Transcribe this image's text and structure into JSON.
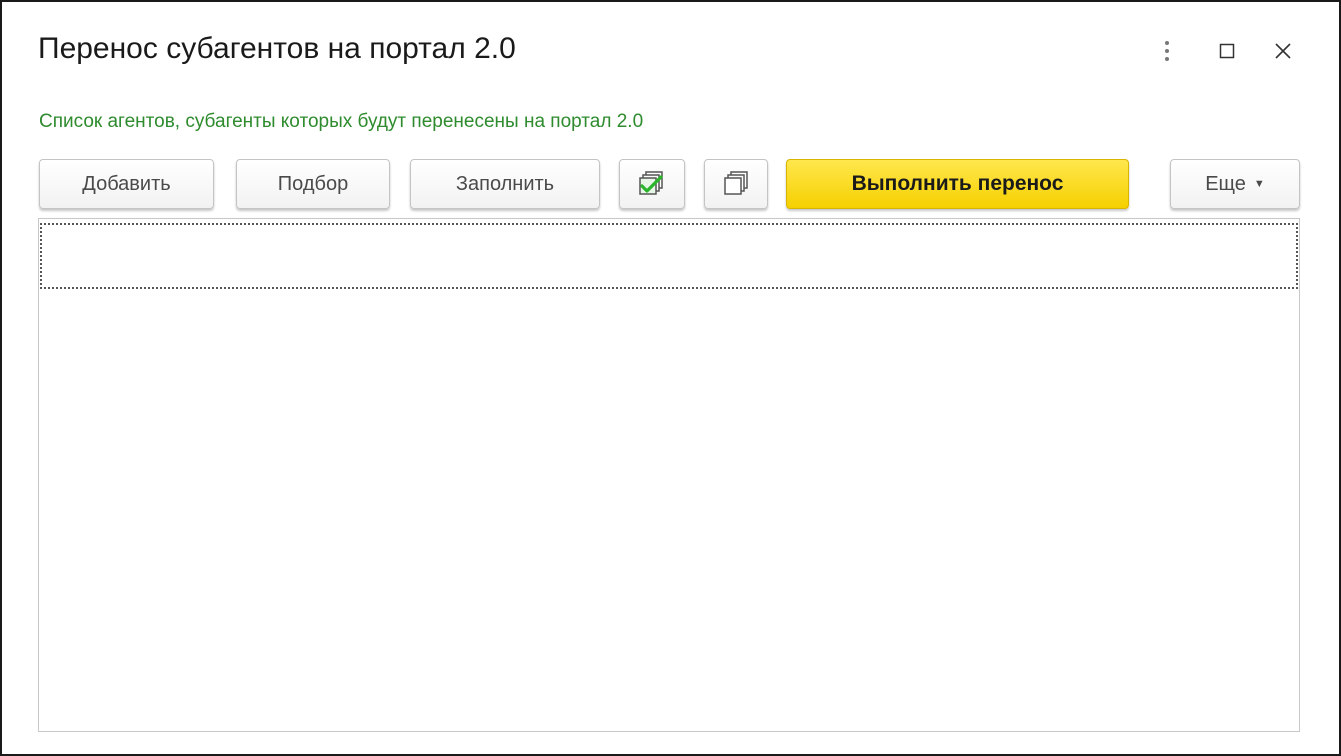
{
  "window": {
    "title": "Перенос субагентов на портал 2.0",
    "subtitle": "Список агентов, субагенты которых будут перенесены на портал 2.0"
  },
  "toolbar": {
    "add_label": "Добавить",
    "pick_label": "Подбор",
    "fill_label": "Заполнить",
    "check_all_icon": "check-all-icon",
    "uncheck_all_icon": "uncheck-all-icon",
    "run_label": "Выполнить перенос",
    "more_label": "Еще"
  },
  "window_controls": {
    "more_icon": "more-vertical-icon",
    "maximize_icon": "maximize-icon",
    "close_icon": "close-icon"
  },
  "colors": {
    "subtitle": "#2e8b2e",
    "primary_button": "#f7d600",
    "check_mark": "#2bb52b"
  },
  "table": {
    "rows": []
  }
}
